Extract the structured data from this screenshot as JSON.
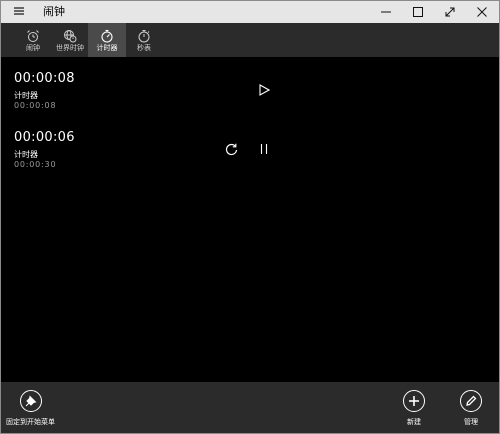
{
  "app": {
    "title": "闹钟",
    "menu_icon": "hamburger-icon",
    "window_controls": [
      "minimize-icon",
      "maximize-icon",
      "fullscreen-icon",
      "close-icon"
    ]
  },
  "tabs": [
    {
      "label": "闹钟",
      "icon": "alarm-clock-icon",
      "active": false
    },
    {
      "label": "世界时钟",
      "icon": "world-clock-icon",
      "active": false
    },
    {
      "label": "计时器",
      "icon": "timer-icon",
      "active": true
    },
    {
      "label": "秒表",
      "icon": "stopwatch-icon",
      "active": false
    }
  ],
  "timers": [
    {
      "time": "00:00:08",
      "name": "计时器",
      "original": "00:00:08",
      "controls": [
        "play-icon"
      ]
    },
    {
      "time": "00:00:06",
      "name": "计时器",
      "original": "00:00:30",
      "controls": [
        "reset-icon",
        "pause-icon"
      ]
    }
  ],
  "bottom_bar": {
    "pin_label": "固定到开始菜单",
    "new_label": "新建",
    "manage_label": "管理"
  },
  "colors": {
    "background": "#000000",
    "bar": "#2b2b2b",
    "active_tab": "#4a4a4a",
    "titlebar": "#e6e6e6"
  }
}
